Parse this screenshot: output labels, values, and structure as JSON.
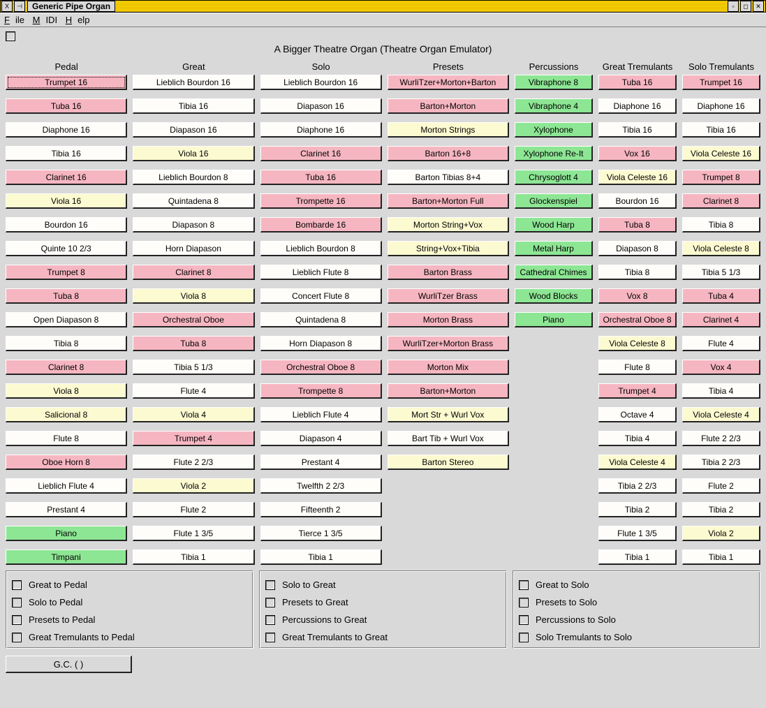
{
  "title": "Generic Pipe Organ",
  "menu": [
    "File",
    "MIDI",
    "Help"
  ],
  "heading": "A Bigger Theatre Organ  (Theatre Organ Emulator)",
  "gc": "G.C. ( )",
  "columns": [
    {
      "name": "Pedal",
      "stops": [
        {
          "label": "Trumpet 16",
          "color": "pink",
          "focused": true
        },
        {
          "label": "Tuba 16",
          "color": "pink"
        },
        {
          "label": "Diaphone 16",
          "color": "white"
        },
        {
          "label": "Tibia 16",
          "color": "white"
        },
        {
          "label": "Clarinet 16",
          "color": "pink"
        },
        {
          "label": "Viola 16",
          "color": "yellow"
        },
        {
          "label": "Bourdon 16",
          "color": "white"
        },
        {
          "label": "Quinte 10 2/3",
          "color": "white"
        },
        {
          "label": "Trumpet 8",
          "color": "pink"
        },
        {
          "label": "Tuba 8",
          "color": "pink"
        },
        {
          "label": "Open Diapason 8",
          "color": "white"
        },
        {
          "label": "Tibia 8",
          "color": "white"
        },
        {
          "label": "Clarinet 8",
          "color": "pink"
        },
        {
          "label": "Viola 8",
          "color": "yellow"
        },
        {
          "label": "Salicional 8",
          "color": "yellow"
        },
        {
          "label": "Flute 8",
          "color": "white"
        },
        {
          "label": "Oboe Horn 8",
          "color": "pink"
        },
        {
          "label": "Lieblich Flute 4",
          "color": "white"
        },
        {
          "label": "Prestant 4",
          "color": "white"
        },
        {
          "label": "Piano",
          "color": "green"
        },
        {
          "label": "Timpani",
          "color": "green"
        }
      ]
    },
    {
      "name": "Great",
      "stops": [
        {
          "label": "Lieblich Bourdon 16",
          "color": "white"
        },
        {
          "label": "Tibia 16",
          "color": "white"
        },
        {
          "label": "Diapason 16",
          "color": "white"
        },
        {
          "label": "Viola 16",
          "color": "yellow"
        },
        {
          "label": "Lieblich Bourdon 8",
          "color": "white"
        },
        {
          "label": "Quintadena 8",
          "color": "white"
        },
        {
          "label": "Diapason 8",
          "color": "white"
        },
        {
          "label": "Horn Diapason",
          "color": "white"
        },
        {
          "label": "Clarinet 8",
          "color": "pink"
        },
        {
          "label": "Viola 8",
          "color": "yellow"
        },
        {
          "label": "Orchestral Oboe",
          "color": "pink"
        },
        {
          "label": "Tuba 8",
          "color": "pink"
        },
        {
          "label": "Tibia 5 1/3",
          "color": "white"
        },
        {
          "label": "Flute 4",
          "color": "white"
        },
        {
          "label": "Viola 4",
          "color": "yellow"
        },
        {
          "label": "Trumpet 4",
          "color": "pink"
        },
        {
          "label": "Flute 2 2/3",
          "color": "white"
        },
        {
          "label": "Viola 2",
          "color": "yellow"
        },
        {
          "label": "Flute 2",
          "color": "white"
        },
        {
          "label": "Flute 1 3/5",
          "color": "white"
        },
        {
          "label": "Tibia 1",
          "color": "white"
        }
      ]
    },
    {
      "name": "Solo",
      "stops": [
        {
          "label": "Lieblich Bourdon 16",
          "color": "white"
        },
        {
          "label": "Diapason 16",
          "color": "white"
        },
        {
          "label": "Diaphone 16",
          "color": "white"
        },
        {
          "label": "Clarinet 16",
          "color": "pink"
        },
        {
          "label": "Tuba 16",
          "color": "pink"
        },
        {
          "label": "Trompette 16",
          "color": "pink"
        },
        {
          "label": "Bombarde 16",
          "color": "pink"
        },
        {
          "label": "Lieblich Bourdon 8",
          "color": "white"
        },
        {
          "label": "Lieblich Flute 8",
          "color": "white"
        },
        {
          "label": "Concert Flute 8",
          "color": "white"
        },
        {
          "label": "Quintadena 8",
          "color": "white"
        },
        {
          "label": "Horn Diapason 8",
          "color": "white"
        },
        {
          "label": "Orchestral Oboe 8",
          "color": "pink"
        },
        {
          "label": "Trompette 8",
          "color": "pink"
        },
        {
          "label": "Lieblich Flute 4",
          "color": "white"
        },
        {
          "label": "Diapason 4",
          "color": "white"
        },
        {
          "label": "Prestant 4",
          "color": "white"
        },
        {
          "label": "Twelfth 2 2/3",
          "color": "white"
        },
        {
          "label": "Fifteenth 2",
          "color": "white"
        },
        {
          "label": "Tierce 1 3/5",
          "color": "white"
        },
        {
          "label": "Tibia 1",
          "color": "white"
        }
      ]
    },
    {
      "name": "Presets",
      "stops": [
        {
          "label": "WurliTzer+Morton+Barton",
          "color": "pink"
        },
        {
          "label": "Barton+Morton",
          "color": "pink"
        },
        {
          "label": "Morton Strings",
          "color": "yellow"
        },
        {
          "label": "Barton 16+8",
          "color": "pink"
        },
        {
          "label": "Barton Tibias 8+4",
          "color": "white"
        },
        {
          "label": "Barton+Morton Full",
          "color": "pink"
        },
        {
          "label": "Morton String+Vox",
          "color": "yellow"
        },
        {
          "label": "String+Vox+Tibia",
          "color": "yellow"
        },
        {
          "label": "Barton Brass",
          "color": "pink"
        },
        {
          "label": "WurliTzer Brass",
          "color": "pink"
        },
        {
          "label": "Morton Brass",
          "color": "pink"
        },
        {
          "label": "WurliTzer+Morton Brass",
          "color": "pink"
        },
        {
          "label": "Morton Mix",
          "color": "pink"
        },
        {
          "label": "Barton+Morton",
          "color": "pink"
        },
        {
          "label": "Mort Str + Wurl Vox",
          "color": "yellow"
        },
        {
          "label": "Bart Tib + Wurl Vox",
          "color": "white"
        },
        {
          "label": "Barton Stereo",
          "color": "yellow"
        }
      ]
    },
    {
      "name": "Percussions",
      "narrow": true,
      "stops": [
        {
          "label": "Vibraphone 8",
          "color": "green"
        },
        {
          "label": "Vibraphone 4",
          "color": "green"
        },
        {
          "label": "Xylophone",
          "color": "green"
        },
        {
          "label": "Xylophone Re-It",
          "color": "green"
        },
        {
          "label": "Chrysoglott 4",
          "color": "green"
        },
        {
          "label": "Glockenspiel",
          "color": "green"
        },
        {
          "label": "Wood Harp",
          "color": "green"
        },
        {
          "label": "Metal Harp",
          "color": "green"
        },
        {
          "label": "Cathedral Chimes",
          "color": "green"
        },
        {
          "label": "Wood Blocks",
          "color": "green"
        },
        {
          "label": "Piano",
          "color": "green"
        }
      ]
    },
    {
      "name": "Great Tremulants",
      "narrow": true,
      "stops": [
        {
          "label": "Tuba 16",
          "color": "pink"
        },
        {
          "label": "Diaphone 16",
          "color": "white"
        },
        {
          "label": "Tibia 16",
          "color": "white"
        },
        {
          "label": "Vox 16",
          "color": "pink"
        },
        {
          "label": "Viola Celeste 16",
          "color": "yellow"
        },
        {
          "label": "Bourdon 16",
          "color": "white"
        },
        {
          "label": "Tuba 8",
          "color": "pink"
        },
        {
          "label": "Diapason 8",
          "color": "white"
        },
        {
          "label": "Tibia 8",
          "color": "white"
        },
        {
          "label": "Vox 8",
          "color": "pink"
        },
        {
          "label": "Orchestral Oboe 8",
          "color": "pink"
        },
        {
          "label": "Viola Celeste 8",
          "color": "yellow"
        },
        {
          "label": "Flute 8",
          "color": "white"
        },
        {
          "label": "Trumpet 4",
          "color": "pink"
        },
        {
          "label": "Octave 4",
          "color": "white"
        },
        {
          "label": "Tibia 4",
          "color": "white"
        },
        {
          "label": "Viola Celeste 4",
          "color": "yellow"
        },
        {
          "label": "Tibia 2 2/3",
          "color": "white"
        },
        {
          "label": "Tibia 2",
          "color": "white"
        },
        {
          "label": "Flute 1 3/5",
          "color": "white"
        },
        {
          "label": "Tibia 1",
          "color": "white"
        }
      ]
    },
    {
      "name": "Solo Tremulants",
      "narrow": true,
      "stops": [
        {
          "label": "Trumpet 16",
          "color": "pink"
        },
        {
          "label": "Diaphone 16",
          "color": "white"
        },
        {
          "label": "Tibia 16",
          "color": "white"
        },
        {
          "label": "Viola Celeste 16",
          "color": "yellow"
        },
        {
          "label": "Trumpet 8",
          "color": "pink"
        },
        {
          "label": "Clarinet 8",
          "color": "pink"
        },
        {
          "label": "Tibia 8",
          "color": "white"
        },
        {
          "label": "Viola Celeste 8",
          "color": "yellow"
        },
        {
          "label": "Tibia 5 1/3",
          "color": "white"
        },
        {
          "label": "Tuba 4",
          "color": "pink"
        },
        {
          "label": "Clarinet 4",
          "color": "pink"
        },
        {
          "label": "Flute 4",
          "color": "white"
        },
        {
          "label": "Vox 4",
          "color": "pink"
        },
        {
          "label": "Tibia 4",
          "color": "white"
        },
        {
          "label": "Viola Celeste 4",
          "color": "yellow"
        },
        {
          "label": "Flute 2 2/3",
          "color": "white"
        },
        {
          "label": "Tibia 2 2/3",
          "color": "white"
        },
        {
          "label": "Flute 2",
          "color": "white"
        },
        {
          "label": "Tibia 2",
          "color": "white"
        },
        {
          "label": "Viola 2",
          "color": "yellow"
        },
        {
          "label": "Tibia 1",
          "color": "white"
        }
      ]
    }
  ],
  "couplers": [
    [
      "Great to Pedal",
      "Solo to Pedal",
      "Presets to Pedal",
      "Great Tremulants to Pedal"
    ],
    [
      "Solo to Great",
      "Presets to Great",
      "Percussions to Great",
      "Great Tremulants to Great"
    ],
    [
      "Great to Solo",
      "Presets to Solo",
      "Percussions to Solo",
      "Solo Tremulants to Solo"
    ]
  ]
}
